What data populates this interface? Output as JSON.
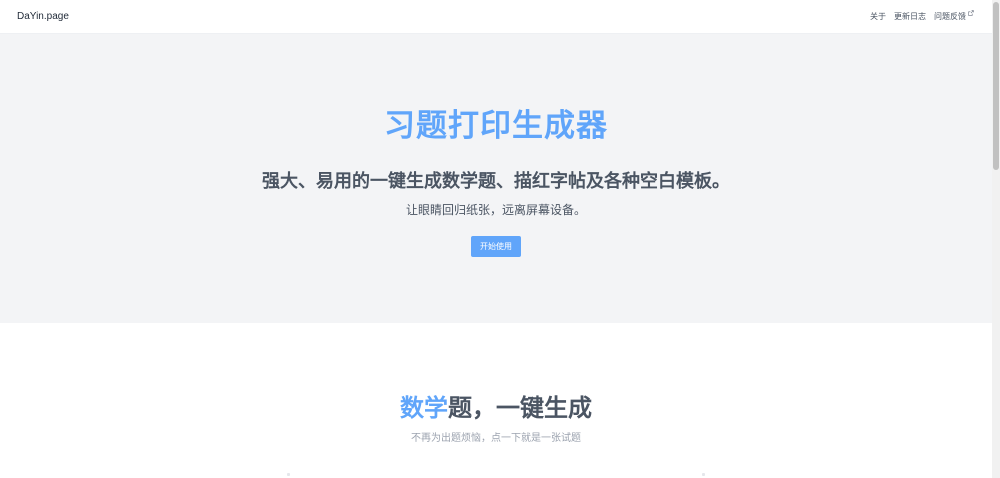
{
  "navbar": {
    "brand": "DaYin.page",
    "links": [
      {
        "label": "关于"
      },
      {
        "label": "更新日志"
      },
      {
        "label": "问题反馈",
        "external": true
      }
    ]
  },
  "hero": {
    "title": "习题打印生成器",
    "subtitle": "强大、易用的一键生成数学题、描红字帖及各种空白模板。",
    "description": "让眼睛回归纸张，远离屏幕设备。",
    "button_label": "开始使用"
  },
  "math_section": {
    "title_highlight": "数学",
    "title_rest": "题，一键生成",
    "description": "不再为出题烦恼，点一下就是一张试题"
  },
  "colors": {
    "accent": "#60a5fa",
    "hero_bg": "#f3f4f6",
    "text": "#4b5563"
  },
  "icons": {
    "external_link": "external-link-icon"
  }
}
